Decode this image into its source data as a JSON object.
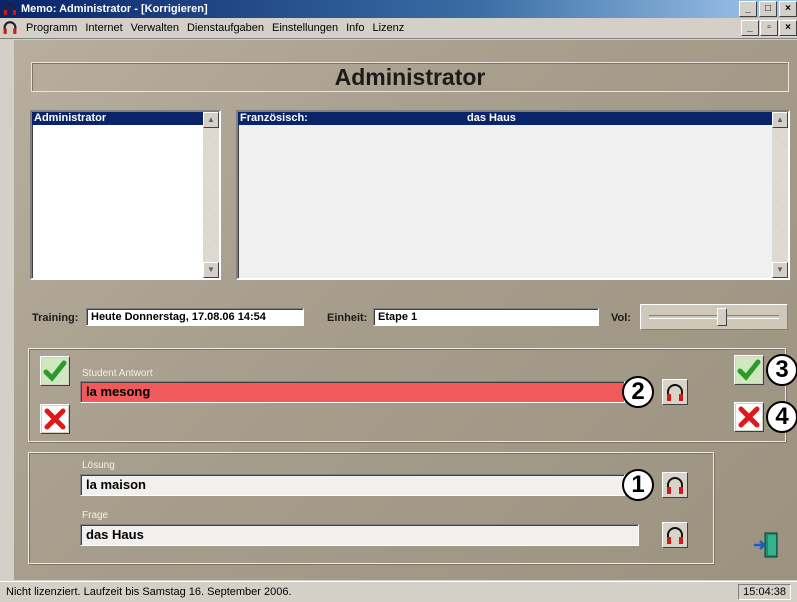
{
  "window": {
    "title": "Memo: Administrator - [Korrigieren]"
  },
  "menu": {
    "items": [
      "Programm",
      "Internet",
      "Verwalten",
      "Dienstaufgaben",
      "Einstellungen",
      "Info",
      "Lizenz"
    ]
  },
  "header": {
    "title": "Administrator"
  },
  "users_list": {
    "selected": "Administrator"
  },
  "word_list": {
    "language_label": "Französisch:",
    "word": "das Haus"
  },
  "training": {
    "label": "Training:",
    "value": "Heute Donnerstag,  17.08.06   14:54"
  },
  "unit": {
    "label": "Einheit:",
    "value": "Etape 1"
  },
  "volume": {
    "label": "Vol:",
    "level": 0.6
  },
  "student": {
    "label": "Student Antwort",
    "answer": "la mesong",
    "answer_color": "#f05a5a"
  },
  "solution": {
    "label": "Lösung",
    "value": "la maison"
  },
  "question": {
    "label": "Frage",
    "value": "das Haus"
  },
  "badges": {
    "b1": "1",
    "b2": "2",
    "b3": "3",
    "b4": "4"
  },
  "status": {
    "text": "Nicht lizenziert. Laufzeit bis Samstag 16. September 2006.",
    "time": "15:04:38"
  },
  "colors": {
    "accent": "#0a246a",
    "check": "#3aa83a",
    "cross": "#e01818"
  },
  "icons": [
    "headphones-icon",
    "check-icon",
    "cross-icon",
    "exit-door-icon"
  ]
}
